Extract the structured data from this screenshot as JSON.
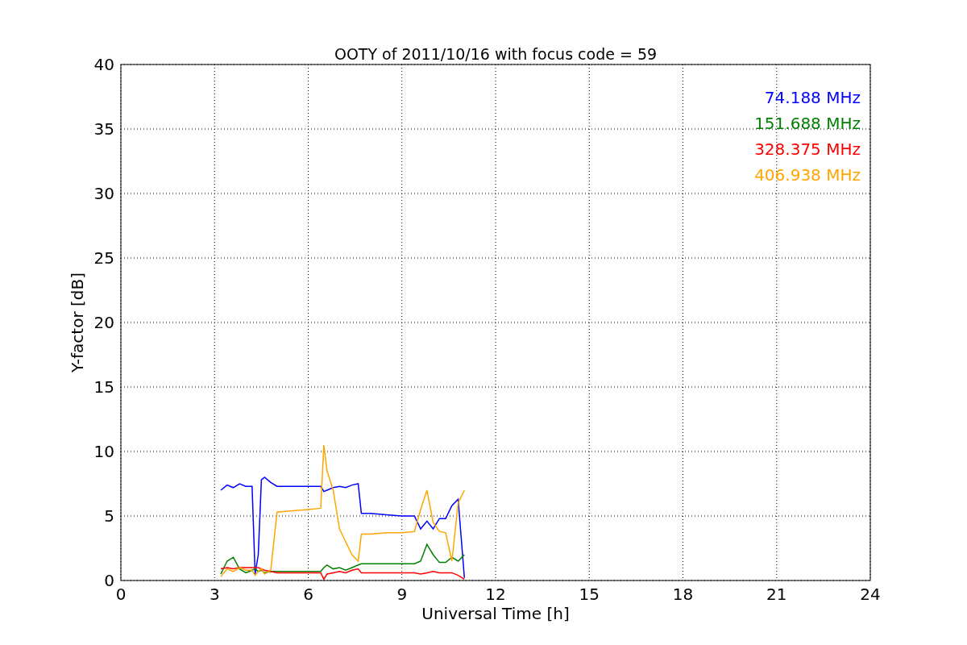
{
  "chart_data": {
    "type": "line",
    "title": "OOTY of 2011/10/16 with focus code = 59",
    "xlabel": "Universal Time [h]",
    "ylabel": "Y-factor [dB]",
    "x": [
      3.2,
      3.4,
      3.6,
      3.8,
      4.0,
      4.2,
      4.3,
      4.4,
      4.5,
      4.6,
      4.8,
      5.0,
      5.5,
      6.0,
      6.4,
      6.5,
      6.6,
      6.8,
      7.0,
      7.2,
      7.4,
      7.6,
      7.7,
      8.0,
      8.5,
      9.0,
      9.4,
      9.6,
      9.8,
      10.0,
      10.2,
      10.4,
      10.6,
      10.8,
      11.0
    ],
    "series": [
      {
        "name": "74.188 MHz",
        "color": "#0000ff",
        "values": [
          7.0,
          7.4,
          7.2,
          7.5,
          7.3,
          7.3,
          0.5,
          2.0,
          7.8,
          8.0,
          7.6,
          7.3,
          7.3,
          7.3,
          7.3,
          6.9,
          7.0,
          7.2,
          7.3,
          7.2,
          7.4,
          7.5,
          5.2,
          5.2,
          5.1,
          5.0,
          5.0,
          4.0,
          4.6,
          4.0,
          4.8,
          4.8,
          5.8,
          6.3,
          0.2
        ]
      },
      {
        "name": "151.688 MHz",
        "color": "#008000",
        "values": [
          0.5,
          1.5,
          1.8,
          0.9,
          0.6,
          0.8,
          0.9,
          0.7,
          0.8,
          0.6,
          0.7,
          0.7,
          0.7,
          0.7,
          0.7,
          1.0,
          1.2,
          0.9,
          1.0,
          0.8,
          1.0,
          1.2,
          1.3,
          1.3,
          1.3,
          1.3,
          1.3,
          1.5,
          2.8,
          2.0,
          1.4,
          1.4,
          1.8,
          1.5,
          2.0
        ]
      },
      {
        "name": "328.375 MHz",
        "color": "#ff0000",
        "values": [
          0.9,
          1.0,
          0.9,
          1.0,
          1.0,
          1.0,
          1.0,
          1.0,
          0.9,
          0.8,
          0.7,
          0.6,
          0.6,
          0.6,
          0.6,
          0.1,
          0.5,
          0.6,
          0.7,
          0.6,
          0.8,
          0.9,
          0.6,
          0.6,
          0.6,
          0.6,
          0.6,
          0.5,
          0.6,
          0.7,
          0.6,
          0.6,
          0.6,
          0.4,
          0.1
        ]
      },
      {
        "name": "406.938 MHz",
        "color": "#ffa500",
        "values": [
          0.3,
          0.9,
          0.7,
          1.0,
          0.8,
          0.8,
          0.4,
          0.7,
          0.9,
          0.5,
          0.8,
          5.3,
          5.4,
          5.5,
          5.6,
          10.5,
          8.5,
          7.0,
          4.0,
          3.0,
          2.0,
          1.5,
          3.6,
          3.6,
          3.7,
          3.7,
          3.8,
          5.5,
          7.0,
          4.5,
          3.8,
          3.7,
          1.5,
          6.0,
          7.0
        ]
      }
    ],
    "xlim": [
      0,
      24
    ],
    "ylim": [
      0,
      40
    ],
    "xticks": [
      0,
      3,
      6,
      9,
      12,
      15,
      18,
      21,
      24
    ],
    "yticks": [
      0,
      5,
      10,
      15,
      20,
      25,
      30,
      35,
      40
    ],
    "grid": true
  }
}
